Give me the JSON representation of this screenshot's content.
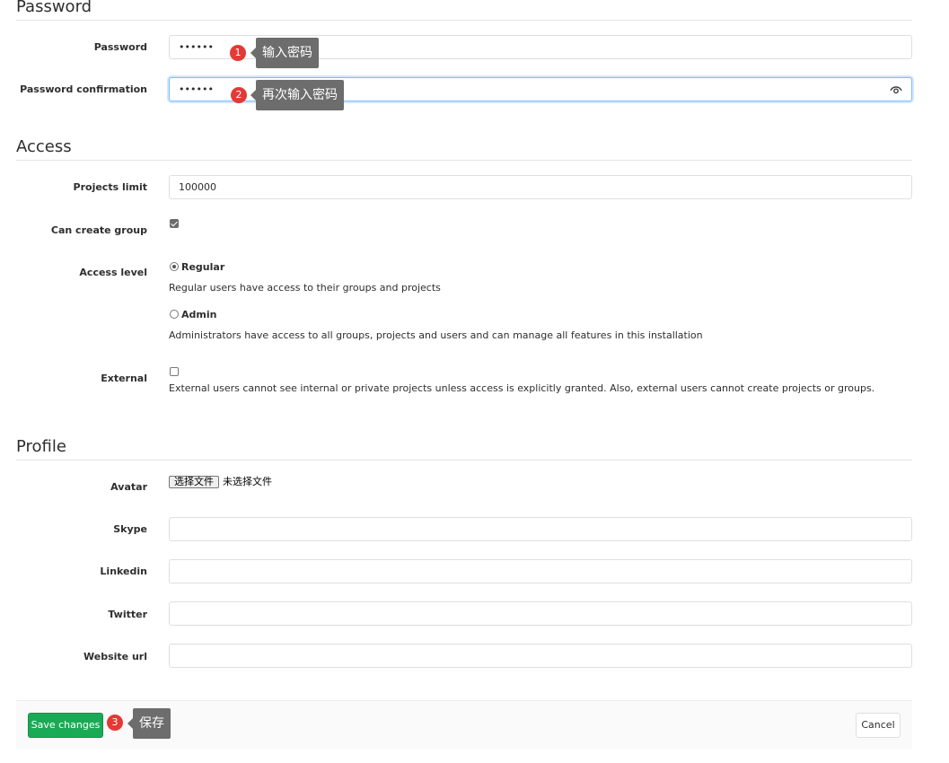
{
  "password_section": {
    "title": "Password",
    "password_label": "Password",
    "password_value": "••••••",
    "confirm_label": "Password confirmation",
    "confirm_value": "••••••"
  },
  "access_section": {
    "title": "Access",
    "projects_limit_label": "Projects limit",
    "projects_limit_value": "100000",
    "can_create_group_label": "Can create group",
    "can_create_group_checked": true,
    "access_level_label": "Access level",
    "regular_title": "Regular",
    "regular_help": "Regular users have access to their groups and projects",
    "admin_title": "Admin",
    "admin_help": "Administrators have access to all groups, projects and users and can manage all features in this installation",
    "selected_level": "Regular",
    "external_label": "External",
    "external_checked": false,
    "external_help": "External users cannot see internal or private projects unless access is explicitly granted. Also, external users cannot create projects or groups."
  },
  "profile_section": {
    "title": "Profile",
    "avatar_label": "Avatar",
    "avatar_button": "选择文件",
    "avatar_status": "未选择文件",
    "skype_label": "Skype",
    "linkedin_label": "Linkedin",
    "twitter_label": "Twitter",
    "website_label": "Website url"
  },
  "footer": {
    "save_label": "Save changes",
    "cancel_label": "Cancel"
  },
  "annotations": [
    {
      "number": "1",
      "text": "输入密码"
    },
    {
      "number": "2",
      "text": "再次输入密码"
    },
    {
      "number": "3",
      "text": "保存"
    }
  ],
  "colors": {
    "save_button": "#1aaa55",
    "annotation_badge": "#e53935",
    "annotation_tip": "#6d6d6d",
    "focus_border": "#80bdff"
  }
}
